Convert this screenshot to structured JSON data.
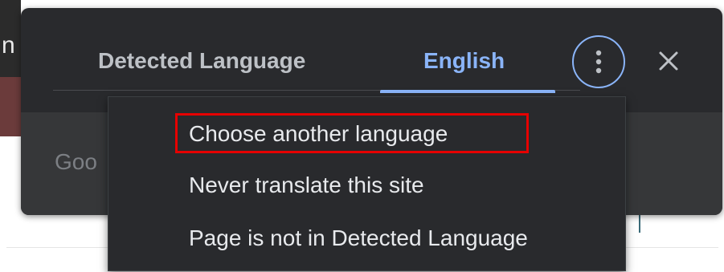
{
  "background": {
    "partial_char": "n",
    "search_partial": "Goo"
  },
  "translate_bubble": {
    "tabs": [
      {
        "label": "Detected Language",
        "selected": false
      },
      {
        "label": "English",
        "selected": true
      }
    ],
    "more_options_icon": "more-vert-icon",
    "close_icon": "close-icon",
    "accent_color": "#8ab4f8"
  },
  "options_menu": {
    "items": [
      {
        "label": "Choose another language",
        "highlighted": true
      },
      {
        "label": "Never translate this site"
      },
      {
        "label": "Page is not in Detected Language"
      }
    ],
    "highlight_color": "#e60000"
  }
}
